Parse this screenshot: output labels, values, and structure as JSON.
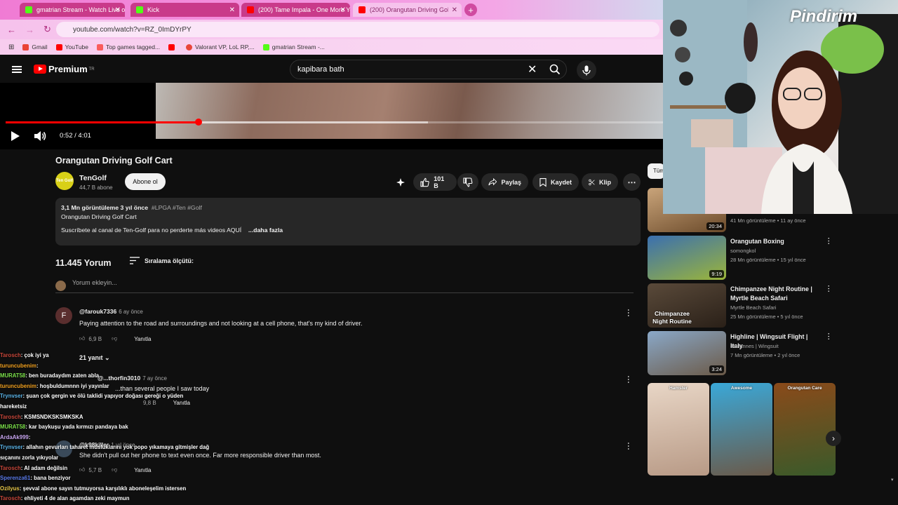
{
  "browser": {
    "tabs": [
      {
        "label": "gmatrian Stream - Watch Live on Kick",
        "color": "#53fc18"
      },
      {
        "label": "Kick",
        "color": "#53fc18"
      },
      {
        "label": "(200) Tame Impala - One More Year",
        "color": "#ff0000"
      },
      {
        "label": "(200) Orangutan Driving Golf Cart",
        "color": "#ff0000"
      }
    ],
    "url": "youtube.com/watch?v=RZ_0ImDYrPY",
    "bookmarks": [
      "Gmail",
      "YouTube",
      "Top games tagged...",
      "",
      "Valorant VP, LoL RP,...",
      "gmatrian Stream -..."
    ]
  },
  "youtube": {
    "logo_text": "Premium",
    "logo_sup": "TR",
    "search_value": "kapibara bath",
    "time": "0:52 / 4:01",
    "progress": 0.293,
    "title": "Orangutan Driving Golf Cart",
    "channel": {
      "name": "TenGolf",
      "avatar_text": "Ten Golf",
      "subs": "44,7 B abone",
      "subscribe": "Abone ol"
    },
    "actions": {
      "likes": "101 B",
      "share": "Paylaş",
      "save": "Kaydet",
      "clip": "Klip"
    },
    "desc": {
      "meta": "3,1 Mn görüntüleme  3 yıl önce",
      "tags": "#LPGA #Ten #Golf",
      "line1": "Orangutan Driving Golf Cart",
      "line2": "Suscríbete al canal de Ten-Golf para no perderte más videos AQUÍ",
      "more": "...daha fazla"
    },
    "comments_count": "11.445 Yorum",
    "sort_label": "Sıralama ölçütü:",
    "add_comment": "Yorum ekleyin...",
    "comments": [
      {
        "avatar": "F",
        "author": "@farouk7336",
        "time": "6 ay önce",
        "text": "Paying attention to the road and surroundings and not looking at a cell phone, that's my kind of driver.",
        "likes": "6,9 B",
        "reply": "Yanıtla"
      },
      {
        "avatar": "",
        "author": "@...thorfin3010",
        "time": "7 ay önce",
        "text": "...than several people I saw today",
        "likes": "9,8 B",
        "reply": "Yanıtla"
      },
      {
        "avatar": "",
        "author": "@k98killer",
        "time": "1 yıl önce",
        "text": "She didn't pull out her phone to text even once. Far more responsible driver than most.",
        "likes": "5,7 B",
        "reply": "Yanıtla"
      }
    ],
    "replies_label": "21 yanıt",
    "chip_label": "Tüm",
    "recs": [
      {
        "title": "",
        "channel": "",
        "meta": "41 Mn görüntüleme • 11 ay önce",
        "dur": "20:34",
        "c1": "#c9a47a",
        "c2": "#6b4a2a"
      },
      {
        "title": "Orangutan Boxing",
        "channel": "somongkol",
        "meta": "28 Mn görüntüleme • 15 yıl önce",
        "dur": "9:19",
        "c1": "#3a6fb0",
        "c2": "#9bb53a"
      },
      {
        "title": "Chimpanzee Night Routine | Myrtle Beach Safari",
        "channel": "Myrtle Beach Safari",
        "meta": "25 Mn görüntüleme • 5 yıl önce",
        "dur": "",
        "c1": "#5a4a3a",
        "c2": "#2a2018"
      },
      {
        "title": "Highline | Wingsuit Flight | Italy",
        "channel": "JoHannes | Wingsuit",
        "meta": "7 Mn görüntüleme • 2 yıl önce",
        "dur": "3:24",
        "c1": "#8aa8c8",
        "c2": "#6b5a48"
      }
    ],
    "rec3_overlay": "Chimpanzee Night Routine",
    "shorts": [
      {
        "title": "Hamster",
        "c1": "#e8d6c6",
        "c2": "#b89a86"
      },
      {
        "title": "Awesome",
        "c1": "#3aa8d8",
        "c2": "#6a5a4a"
      },
      {
        "title": "Orangutan Care",
        "c1": "#8a4a1a",
        "c2": "#3a5a2a"
      }
    ]
  },
  "stream": {
    "logo": "Pindirim"
  },
  "chat": [
    {
      "user": "Tarosch",
      "msg": ": çok iyi ya",
      "color": "#c8473a"
    },
    {
      "user": "turuncubenim",
      "msg": ":",
      "color": "#f0a020"
    },
    {
      "user": "MURAT58",
      "msg": ": ben buradaydım zaten abla",
      "color": "#7be04a"
    },
    {
      "user": "turuncubenim",
      "msg": ": hoşbuldumnnn iyi yayınlar",
      "color": "#f0a020"
    },
    {
      "user": "Trynvser",
      "msg": ": şuan çok gergin ve ölü taklidi yapıyor doğası gereği o yüden",
      "color": "#5ab4e8"
    },
    {
      "user": "",
      "msg": "hareketsiz",
      "color": "#ffffff"
    },
    {
      "user": "Tarosch",
      "msg": ": KSMSNDKSKSMKSKA",
      "color": "#c8473a"
    },
    {
      "user": "MURAT58",
      "msg": ": kar baykuşu yada kırmızı pandaya bak",
      "color": "#7be04a"
    },
    {
      "user": "ArdaAk999",
      "msg": ":",
      "color": "#c8a6f0"
    },
    {
      "user": "Trynvser",
      "msg": ": allahın gevurları taharet musluklarını yok popo yıkamaya gitmişler dağ",
      "color": "#5ab4e8"
    },
    {
      "user": "",
      "msg": "sıçanını zorla yıkıyolar",
      "color": "#ffffff"
    },
    {
      "user": "Tarosch",
      "msg": ": AI adam değilsin",
      "color": "#c8473a"
    },
    {
      "user": "Sperenza61",
      "msg": ": bana benziyor",
      "color": "#5a7ae8"
    },
    {
      "user": "Ozilyus",
      "msg": ": şevval abone sayın tutmuyorsa karşılıklı aboneleşelim istersen",
      "color": "#e8c84a"
    },
    {
      "user": "Tarosch",
      "msg": ": ehliyeti 4 de alan agamdan zeki maymun",
      "color": "#c8473a"
    }
  ]
}
